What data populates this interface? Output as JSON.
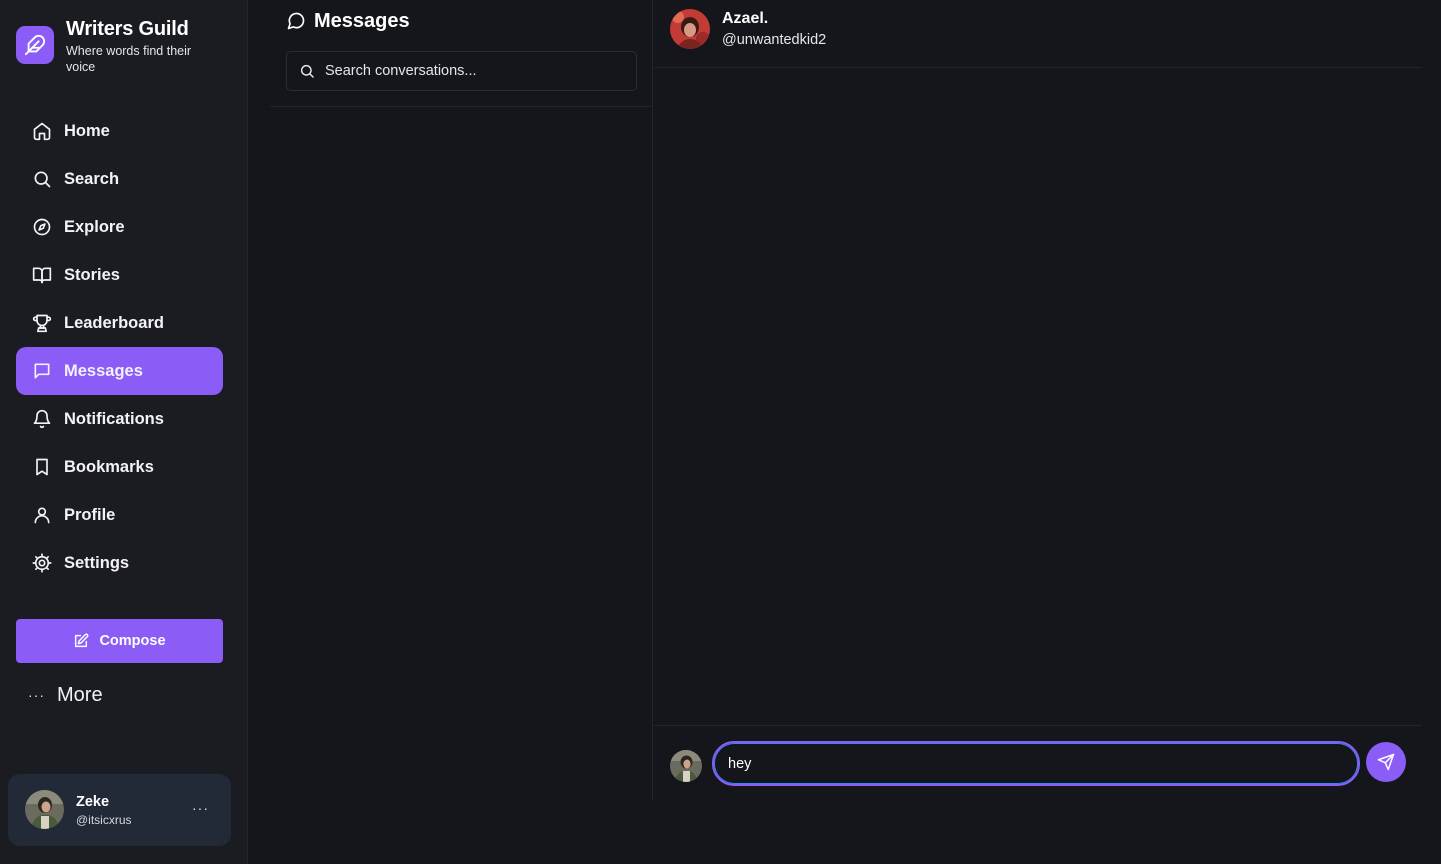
{
  "brand": {
    "name": "Writers Guild",
    "tagline": "Where words find their voice",
    "icon": "feather-icon",
    "accent": "#8b5cf6"
  },
  "nav": [
    {
      "label": "Home",
      "icon": "home-icon"
    },
    {
      "label": "Search",
      "icon": "search-icon"
    },
    {
      "label": "Explore",
      "icon": "compass-icon"
    },
    {
      "label": "Stories",
      "icon": "book-open-icon"
    },
    {
      "label": "Leaderboard",
      "icon": "trophy-icon"
    },
    {
      "label": "Messages",
      "icon": "message-circle-icon",
      "active": true
    },
    {
      "label": "Notifications",
      "icon": "bell-icon"
    },
    {
      "label": "Bookmarks",
      "icon": "bookmark-icon"
    },
    {
      "label": "Profile",
      "icon": "user-icon"
    },
    {
      "label": "Settings",
      "icon": "gear-icon"
    }
  ],
  "compose": {
    "label": "Compose",
    "icon": "edit-icon"
  },
  "more": {
    "label": "More",
    "icon": "ellipsis-icon"
  },
  "current_user": {
    "name": "Zeke",
    "handle": "@itsicxrus"
  },
  "conversations": {
    "title": "Messages",
    "search_placeholder": "Search conversations..."
  },
  "chat": {
    "contact_name": "Azael.",
    "contact_handle": "@unwantedkid2",
    "input_value": "hey",
    "send_icon": "send-icon"
  },
  "colors": {
    "background": "#15161b",
    "sidebar": "#1b1c22",
    "user_card": "#222a38",
    "accent": "#8b5cf6"
  }
}
